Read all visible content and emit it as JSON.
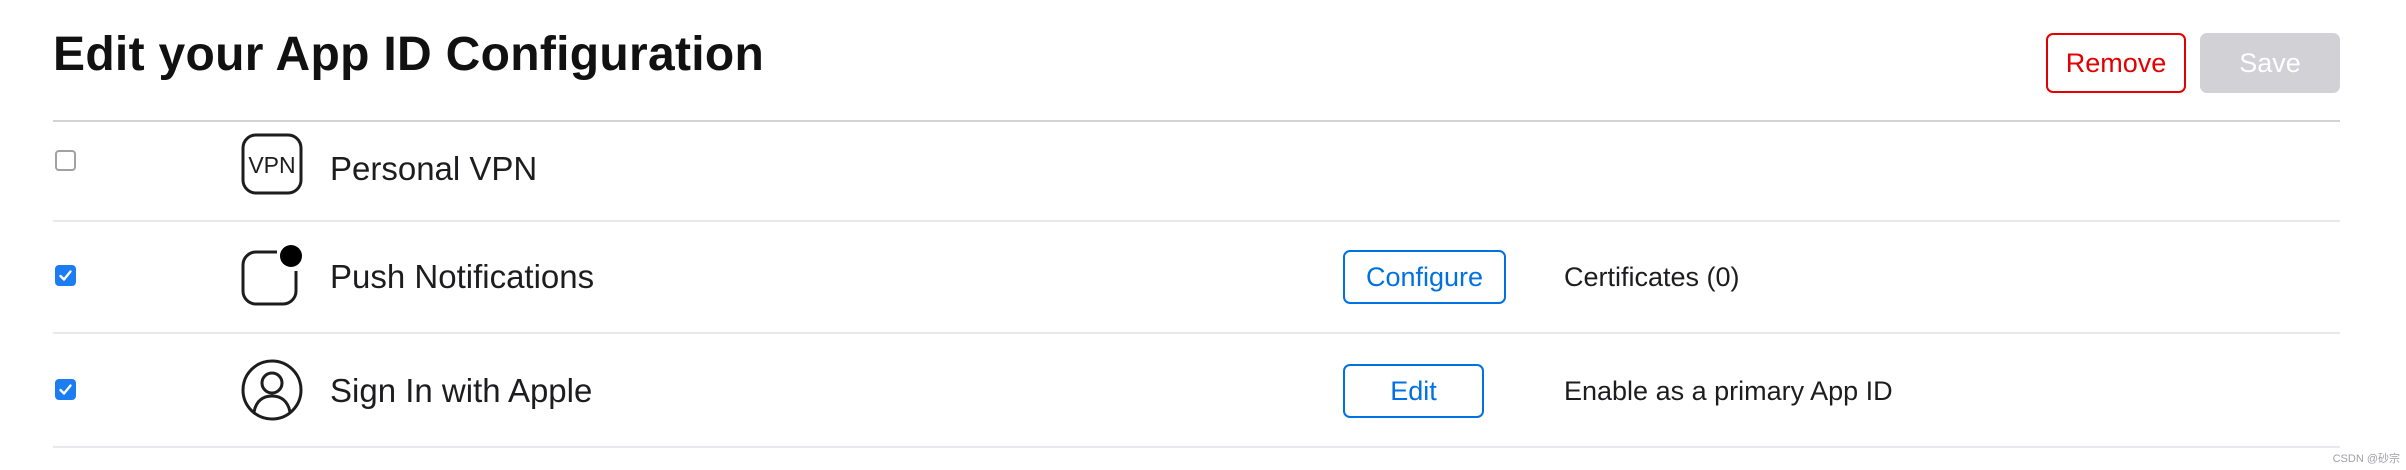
{
  "header": {
    "title": "Edit your App ID Configuration",
    "remove_label": "Remove",
    "save_label": "Save"
  },
  "capabilities": [
    {
      "name": "Personal VPN",
      "icon": "vpn-icon",
      "icon_text": "VPN",
      "enabled": false
    },
    {
      "name": "Push Notifications",
      "icon": "push-notification-icon",
      "enabled": true,
      "action_label": "Configure",
      "detail": "Certificates (0)"
    },
    {
      "name": "Sign In with Apple",
      "icon": "person-icon",
      "enabled": true,
      "action_label": "Edit",
      "detail": "Enable as a primary App ID"
    }
  ],
  "watermark": "CSDN @砂宗",
  "colors": {
    "accent": "#0071e3",
    "destructive": "#e30000",
    "checkbox_checked": "#1c7cf2",
    "disabled_button": "#d1d1d6"
  }
}
